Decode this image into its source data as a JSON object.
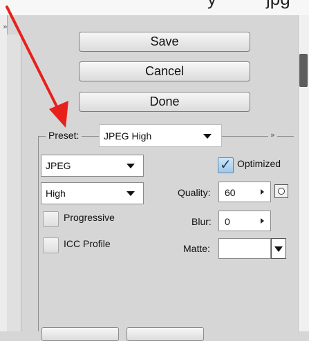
{
  "top_text": {
    "left": "y",
    "right": "jpg"
  },
  "panel": {
    "save_label": "Save",
    "cancel_label": "Cancel",
    "done_label": "Done",
    "expand_icon": "double-chevron-right",
    "collapse_icon": "double-chevron-right"
  },
  "settings": {
    "preset_label": "Preset:",
    "preset_value": "JPEG High",
    "format_value": "JPEG",
    "quality_preset_value": "High",
    "optimized_label": "Optimized",
    "optimized_checked": true,
    "progressive_label": "Progressive",
    "progressive_checked": false,
    "icc_label": "ICC Profile",
    "icc_checked": false,
    "quality_label": "Quality:",
    "quality_value": "60",
    "blur_label": "Blur:",
    "blur_value": "0",
    "matte_label": "Matte:",
    "matte_value": ""
  },
  "colors": {
    "annotation_arrow": "#e8201c",
    "panel_bg": "#d6d6d6",
    "checkbox_checked": "#9ec8e8"
  }
}
